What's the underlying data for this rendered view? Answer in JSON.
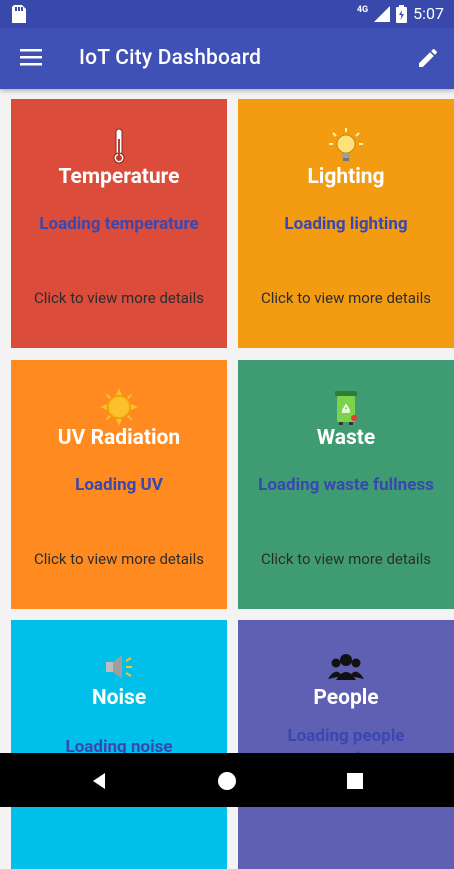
{
  "status_bar": {
    "network": "4G",
    "time": "5:07"
  },
  "app_bar": {
    "title": "IoT City Dashboard"
  },
  "cards": [
    {
      "title": "Temperature",
      "status": "Loading temperature",
      "hint": "Click to view more details",
      "color": "#dc4c3a",
      "icon": "thermometer-icon"
    },
    {
      "title": "Lighting",
      "status": "Loading lighting",
      "hint": "Click to view more details",
      "color": "#f39c12",
      "icon": "lightbulb-icon"
    },
    {
      "title": "UV Radiation",
      "status": "Loading UV",
      "hint": "Click to view more details",
      "color": "#ff8a1f",
      "icon": "sun-icon"
    },
    {
      "title": "Waste",
      "status": "Loading waste fullness",
      "hint": "Click to view more details",
      "color": "#3f9c72",
      "icon": "recycling-bin-icon"
    },
    {
      "title": "Noise",
      "status": "Loading noise",
      "hint": "",
      "color": "#00bfe8",
      "icon": "speaker-icon"
    },
    {
      "title": "People",
      "status": "Loading people presentage",
      "hint": "",
      "color": "#5f5fb3",
      "icon": "people-icon"
    }
  ],
  "nav_bar": {
    "buttons": [
      "back-icon",
      "home-icon",
      "recents-icon"
    ]
  }
}
